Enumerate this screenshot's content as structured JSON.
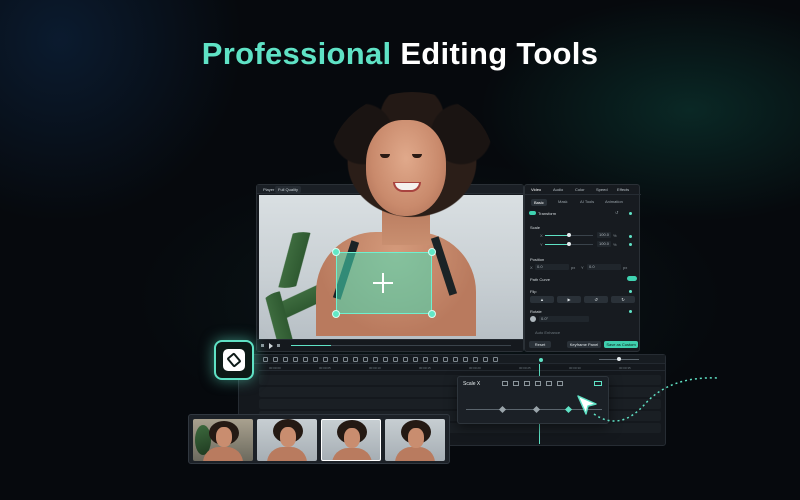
{
  "headline": {
    "accent": "Professional",
    "rest": " Editing Tools"
  },
  "preview": {
    "tabs": [
      "Player",
      "Full Quality"
    ]
  },
  "panel": {
    "tabs": [
      "Video",
      "Audio",
      "Color",
      "Speed",
      "Effects"
    ],
    "subtabs": [
      "Basic",
      "Mask",
      "AI Tools",
      "Animation"
    ],
    "sections": {
      "transform": "Transform",
      "scale": "Scale",
      "scale_x_label": "X",
      "scale_x_value": "100.0",
      "scale_y_label": "Y",
      "scale_y_value": "100.0",
      "unit": "%",
      "position": "Position",
      "pos_x_label": "X",
      "pos_x_value": "0.0",
      "pos_y_label": "Y",
      "pos_y_value": "0.0",
      "px": "px",
      "path_curve": "Path Curve",
      "flip": "Flip",
      "rotate": "Rotate",
      "rotate_value": "0.0°",
      "auto_enhance": "Auto Enhance"
    },
    "buttons": {
      "reset": "Reset",
      "keyframe": "Keyframe Panel",
      "save": "Save as Custom"
    }
  },
  "timeline": {
    "ruler": [
      "00:00:00",
      "00:00:05",
      "00:00:10",
      "00:00:15",
      "00:00:20",
      "00:00:25",
      "00:00:30",
      "00:00:35"
    ]
  },
  "keyframe": {
    "title": "Scale X"
  },
  "colors": {
    "accent": "#5fe2c5",
    "background": "#06090d"
  },
  "icons": [
    "mask-tool-icon",
    "plus-icon",
    "cursor-icon",
    "keyframe-diamond-icon"
  ]
}
